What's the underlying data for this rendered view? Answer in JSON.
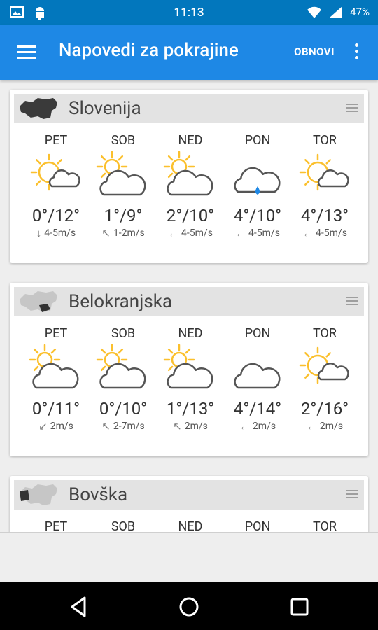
{
  "status": {
    "time": "11:13",
    "battery": "47%"
  },
  "appbar": {
    "title": "Napovedi za pokrajine",
    "refresh_label": "OBNOVI"
  },
  "regions": [
    {
      "name": "Slovenija",
      "days": [
        {
          "day": "PET",
          "icon": "sun-cloud-icon",
          "temp": "0°/12°",
          "wind_dir": "↓",
          "wind": "4-5m/s"
        },
        {
          "day": "SOB",
          "icon": "partly-cloudy-icon",
          "temp": "1°/9°",
          "wind_dir": "↖",
          "wind": "1-2m/s"
        },
        {
          "day": "NED",
          "icon": "partly-cloudy-icon",
          "temp": "2°/10°",
          "wind_dir": "←",
          "wind": "4-5m/s"
        },
        {
          "day": "PON",
          "icon": "rain-cloud-icon",
          "temp": "4°/10°",
          "wind_dir": "←",
          "wind": "4-5m/s"
        },
        {
          "day": "TOR",
          "icon": "sun-cloud-icon",
          "temp": "4°/13°",
          "wind_dir": "←",
          "wind": "4-5m/s"
        }
      ]
    },
    {
      "name": "Belokranjska",
      "days": [
        {
          "day": "PET",
          "icon": "partly-cloudy-icon",
          "temp": "0°/11°",
          "wind_dir": "↙",
          "wind": "2m/s"
        },
        {
          "day": "SOB",
          "icon": "partly-cloudy-icon",
          "temp": "0°/10°",
          "wind_dir": "↖",
          "wind": "2-7m/s"
        },
        {
          "day": "NED",
          "icon": "partly-cloudy-icon",
          "temp": "1°/13°",
          "wind_dir": "↖",
          "wind": "2m/s"
        },
        {
          "day": "PON",
          "icon": "cloud-icon",
          "temp": "4°/14°",
          "wind_dir": "←",
          "wind": "2m/s"
        },
        {
          "day": "TOR",
          "icon": "sun-cloud-icon",
          "temp": "2°/16°",
          "wind_dir": "←",
          "wind": "2m/s"
        }
      ]
    },
    {
      "name": "Bovška",
      "days": [
        {
          "day": "PET"
        },
        {
          "day": "SOB"
        },
        {
          "day": "NED"
        },
        {
          "day": "PON"
        },
        {
          "day": "TOR"
        }
      ]
    }
  ],
  "colors": {
    "appbar": "#1e88e5",
    "statusbar": "#0277bd",
    "sun": "#fbc02d",
    "rain": "#1e88e5"
  }
}
